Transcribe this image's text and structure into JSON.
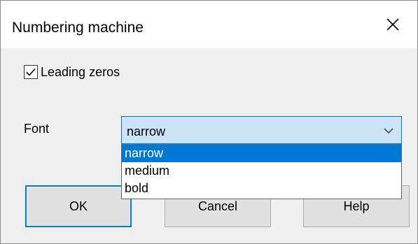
{
  "window": {
    "title": "Numbering machine",
    "close_icon": "close-icon"
  },
  "options": {
    "leading_zeros": {
      "label": "Leading zeros",
      "checked": true
    }
  },
  "font": {
    "label": "Font",
    "selected_value": "narrow",
    "dropdown_open": true,
    "items": [
      {
        "label": "narrow",
        "highlighted": true
      },
      {
        "label": "medium",
        "highlighted": false
      },
      {
        "label": "bold",
        "highlighted": false
      }
    ]
  },
  "buttons": {
    "ok": "OK",
    "cancel": "Cancel",
    "help": "Help"
  },
  "colors": {
    "accent": "#0078d7",
    "select_background": "#cce4f7",
    "dialog_background": "#f0f0f0",
    "titlebar_background": "#ffffff"
  }
}
